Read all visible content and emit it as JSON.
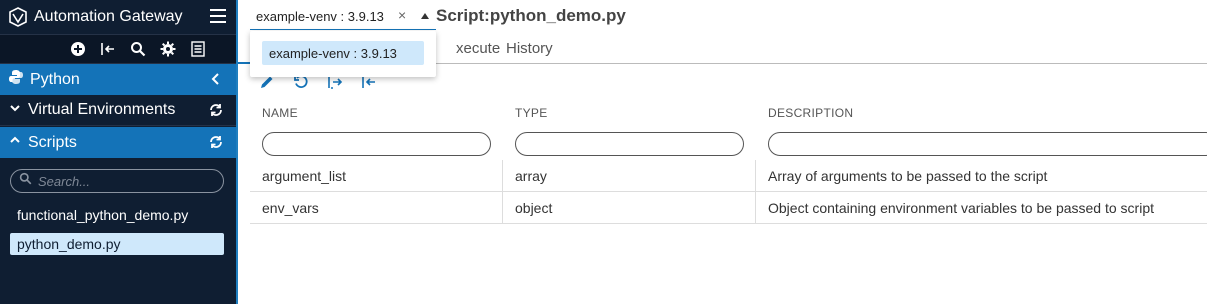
{
  "app": {
    "title": "Automation Gateway",
    "logo_icon": "automation-gateway-logo-icon",
    "menu_icon": "hamburger-icon"
  },
  "sidebar": {
    "toolbar_icons": [
      "add-icon",
      "logout-icon",
      "search-icon",
      "gear-icon",
      "list-icon"
    ],
    "sections": {
      "python": {
        "label": "Python",
        "icon": "python-icon",
        "toggle_icon": "chevron-left-icon"
      },
      "venv": {
        "label": "Virtual Environments",
        "icon": "chevron-down-icon",
        "action_icon": "refresh-icon"
      },
      "scripts": {
        "label": "Scripts",
        "icon": "chevron-up-icon",
        "action_icon": "refresh-icon"
      }
    },
    "search": {
      "placeholder": "Search..."
    },
    "scripts": [
      "functional_python_demo.py",
      "python_demo.py"
    ],
    "selected_script": "python_demo.py"
  },
  "main": {
    "env_select": {
      "value": "example-venv : 3.9.13",
      "options": [
        "example-venv : 3.9.13"
      ]
    },
    "title": "Script:python_demo.py",
    "tabs": {
      "execute": "xecute",
      "history": "History"
    },
    "actions": [
      "edit-icon",
      "undo-icon",
      "export-icon",
      "import-icon"
    ],
    "table": {
      "columns": [
        "NAME",
        "TYPE",
        "DESCRIPTION"
      ],
      "rows": [
        {
          "name": "argument_list",
          "type": "array",
          "description": "Array of arguments to be passed to the script"
        },
        {
          "name": "env_vars",
          "type": "object",
          "description": "Object containing environment variables to be passed to script"
        }
      ]
    }
  },
  "colors": {
    "sidebar_bg": "#0f1e32",
    "accent": "#1473b8",
    "selection": "#cfe8fb"
  }
}
